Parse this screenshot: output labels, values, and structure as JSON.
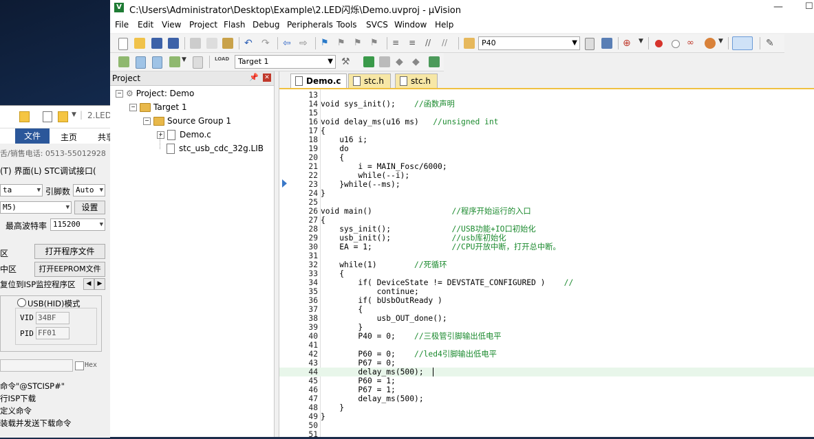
{
  "window": {
    "title": "C:\\Users\\Administrator\\Desktop\\Example\\2.LED闪烁\\Demo.uvproj - µVision",
    "app_icon": "uvision-logo-icon"
  },
  "menu": [
    "File",
    "Edit",
    "View",
    "Project",
    "Flash",
    "Debug",
    "Peripherals",
    "Tools",
    "SVCS",
    "Window",
    "Help"
  ],
  "toolbar1": {
    "find_value": "P40"
  },
  "toolbar2": {
    "target_value": "Target 1"
  },
  "project_panel": {
    "header": "Project",
    "root": "Project: Demo",
    "target": "Target 1",
    "group": "Source Group 1",
    "files": [
      "Demo.c",
      "stc_usb_cdc_32g.LIB"
    ]
  },
  "tabs": [
    "Demo.c",
    "stc.h",
    "stc.h"
  ],
  "code": [
    {
      "n": "13",
      "t": ""
    },
    {
      "n": "14",
      "t": "void sys_init();    ",
      "c": "//函数声明"
    },
    {
      "n": "15",
      "t": ""
    },
    {
      "n": "16",
      "t": "void delay_ms(u16 ms)   ",
      "c": "//unsigned int"
    },
    {
      "n": "17",
      "t": "{"
    },
    {
      "n": "18",
      "t": "    u16 i;"
    },
    {
      "n": "19",
      "t": "    do"
    },
    {
      "n": "20",
      "t": "    {"
    },
    {
      "n": "21",
      "t": "        i = MAIN_Fosc/6000;"
    },
    {
      "n": "22",
      "t": "        while(--i);"
    },
    {
      "n": "23",
      "t": "    }while(--ms);"
    },
    {
      "n": "24",
      "t": "}"
    },
    {
      "n": "25",
      "t": ""
    },
    {
      "n": "26",
      "t": "void main()                 ",
      "c": "//程序开始运行的入口"
    },
    {
      "n": "27",
      "t": "{"
    },
    {
      "n": "28",
      "t": "    sys_init();             ",
      "c": "//USB功能+IO口初始化"
    },
    {
      "n": "29",
      "t": "    usb_init();             ",
      "c": "//usb库初始化"
    },
    {
      "n": "30",
      "t": "    EA = 1;                 ",
      "c": "//CPU开放中断，打开总中断。"
    },
    {
      "n": "31",
      "t": ""
    },
    {
      "n": "32",
      "t": "    while(1)        ",
      "c": "//死循环"
    },
    {
      "n": "33",
      "t": "    {"
    },
    {
      "n": "34",
      "t": "        if( DeviceState != DEVSTATE_CONFIGURED )    ",
      "c": "//"
    },
    {
      "n": "35",
      "t": "            continue;"
    },
    {
      "n": "36",
      "t": "        if( bUsbOutReady )"
    },
    {
      "n": "37",
      "t": "        {"
    },
    {
      "n": "38",
      "t": "            usb_OUT_done();"
    },
    {
      "n": "39",
      "t": "        }"
    },
    {
      "n": "40",
      "t": "        P40 = 0;    ",
      "c": "//三极管引脚输出低电平"
    },
    {
      "n": "41",
      "t": ""
    },
    {
      "n": "42",
      "t": "        P60 = 0;    ",
      "c": "//led4引脚输出低电平"
    },
    {
      "n": "43",
      "t": "        P67 = 0;"
    },
    {
      "n": "44",
      "t": "        delay_ms(500);"
    },
    {
      "n": "45",
      "t": "        P60 = 1;"
    },
    {
      "n": "46",
      "t": "        P67 = 1;"
    },
    {
      "n": "47",
      "t": "        delay_ms(500);"
    },
    {
      "n": "48",
      "t": "    }"
    },
    {
      "n": "49",
      "t": "}"
    },
    {
      "n": "50",
      "t": ""
    },
    {
      "n": "51",
      "t": ""
    }
  ],
  "background_window": {
    "title_fragment": "2.LED",
    "ribbon": {
      "file": "文件",
      "home": "主页",
      "share": "共享"
    },
    "phone": "舌/销售电话: 0513-55012928",
    "menu_fragment": "(T)  界面(L)  STC调试接口(",
    "chip_fragment": "ta",
    "pin_label": "引脚数",
    "pin_value": "Auto",
    "com_fragment": "M5)",
    "settings_button": "设置",
    "baud_label": "最高波特率",
    "baud_value": "115200",
    "open_program": "打开程序文件",
    "region1": "区",
    "open_eeprom": "打开EEPROM文件",
    "region2": "中区",
    "isp_reset": "复位到ISP监控程序区",
    "usb_mode": "USB(HID)模式",
    "vid_label": "VID",
    "vid_value": "34BF",
    "pid_label": "PID",
    "pid_value": "FF01",
    "hex_label": "Hex",
    "cmd1": "命令\"@STCISP#\"",
    "cmd2": "行ISP下载",
    "cmd3": "定义命令",
    "cmd4": "装载并发送下载命令"
  }
}
